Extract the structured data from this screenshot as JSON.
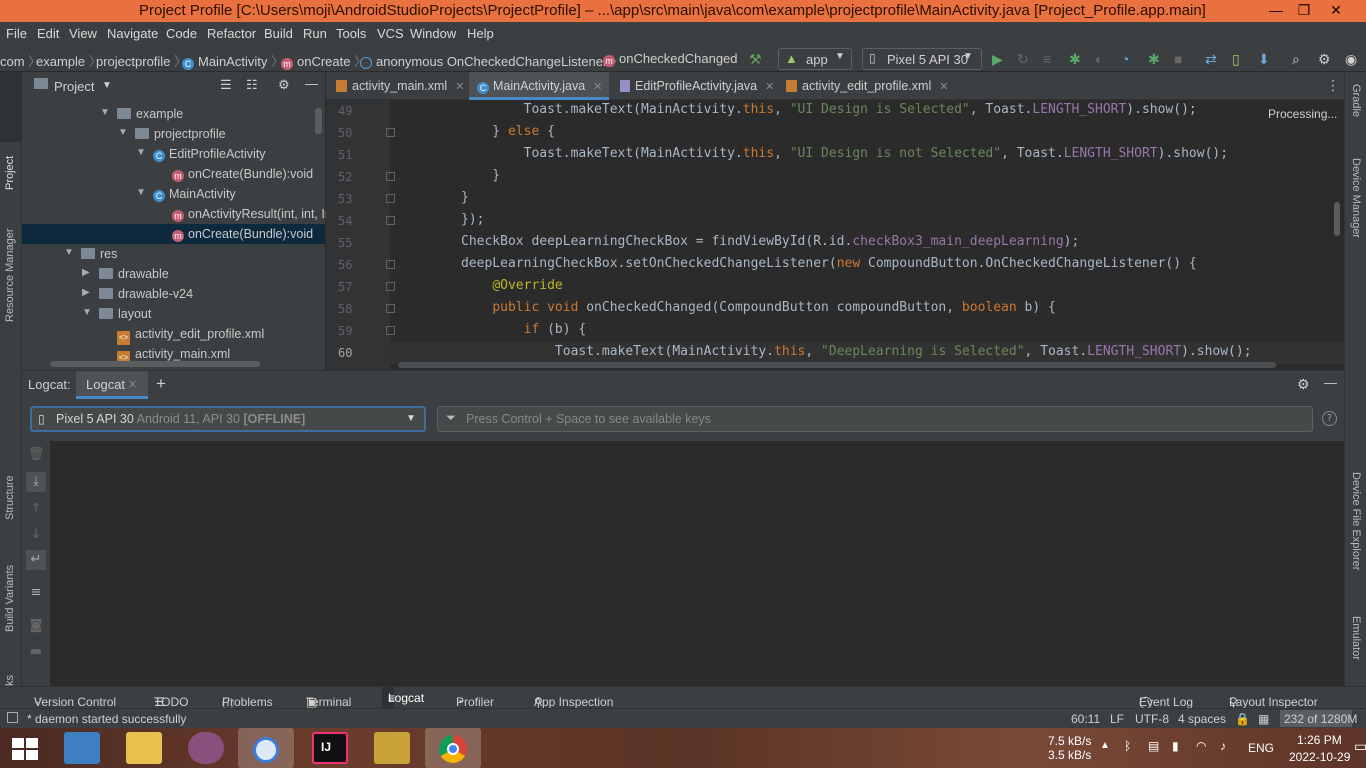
{
  "window": {
    "title": "Project Profile [C:\\Users\\moji\\AndroidStudioProjects\\ProjectProfile] – ...\\app\\src\\main\\java\\com\\example\\projectprofile\\MainActivity.java [Project_Profile.app.main]",
    "minimize": "—",
    "maximize": "❐",
    "close": "✕"
  },
  "menu": [
    "File",
    "Edit",
    "View",
    "Navigate",
    "Code",
    "Refactor",
    "Build",
    "Run",
    "Tools",
    "VCS",
    "Window",
    "Help"
  ],
  "breadcrumbs": [
    "com",
    "example",
    "projectprofile",
    "MainActivity",
    "onCreate",
    "anonymous OnCheckedChangeListener",
    "onCheckedChanged"
  ],
  "toolbar": {
    "config": "app",
    "device": "Pixel 5 API 30"
  },
  "colors": {
    "accent": "#4a88c7",
    "titlebar": "#e9703f",
    "selection": "#0d293e"
  },
  "project_panel": {
    "title": "Project",
    "tree": [
      {
        "label": "example",
        "type": "package"
      },
      {
        "label": "projectprofile",
        "type": "package"
      },
      {
        "label": "EditProfileActivity",
        "type": "class"
      },
      {
        "label": "onCreate(Bundle):void",
        "type": "method"
      },
      {
        "label": "MainActivity",
        "type": "class"
      },
      {
        "label": "onActivityResult(int, int, In",
        "type": "method"
      },
      {
        "label": "onCreate(Bundle):void",
        "type": "method"
      },
      {
        "label": "res",
        "type": "folder"
      },
      {
        "label": "drawable",
        "type": "folder"
      },
      {
        "label": "drawable-v24",
        "type": "folder"
      },
      {
        "label": "layout",
        "type": "folder"
      },
      {
        "label": "activity_edit_profile.xml",
        "type": "xml"
      },
      {
        "label": "activity_main.xml",
        "type": "xml"
      }
    ]
  },
  "editor_tabs": [
    {
      "label": "activity_main.xml"
    },
    {
      "label": "MainActivity.java"
    },
    {
      "label": "EditProfileActivity.java"
    },
    {
      "label": "activity_edit_profile.xml"
    }
  ],
  "editor": {
    "processing": "Processing...",
    "line_numbers": [
      "49",
      "50",
      "51",
      "52",
      "53",
      "54",
      "55",
      "56",
      "57",
      "58",
      "59",
      "60"
    ]
  },
  "left_strip": [
    "Project",
    "Resource Manager",
    "Structure",
    "Build Variants",
    "Bookmarks"
  ],
  "right_strip": [
    "Gradle",
    "Device Manager",
    "Device File Explorer",
    "Emulator"
  ],
  "logcat": {
    "label": "Logcat:",
    "tab": "Logcat",
    "device_name": "Pixel 5 API 30",
    "device_detail": "Android 11, API 30",
    "device_status": "[OFFLINE]",
    "filter_placeholder": "Press Control + Space to see available keys"
  },
  "bottom_tabs": [
    "Version Control",
    "TODO",
    "Problems",
    "Terminal",
    "Logcat",
    "Profiler",
    "App Inspection"
  ],
  "bottom_right_tabs": [
    "Event Log",
    "Layout Inspector"
  ],
  "status": {
    "message": "* daemon started successfully",
    "position": "60:11",
    "line_sep": "LF",
    "encoding": "UTF-8",
    "indent": "4 spaces",
    "memory": "232 of 1280M"
  },
  "taskbar": {
    "net_up": "7.5 kB/s",
    "net_down": "3.5 kB/s",
    "lang": "ENG",
    "time": "1:26 PM",
    "date": "2022-10-29"
  }
}
